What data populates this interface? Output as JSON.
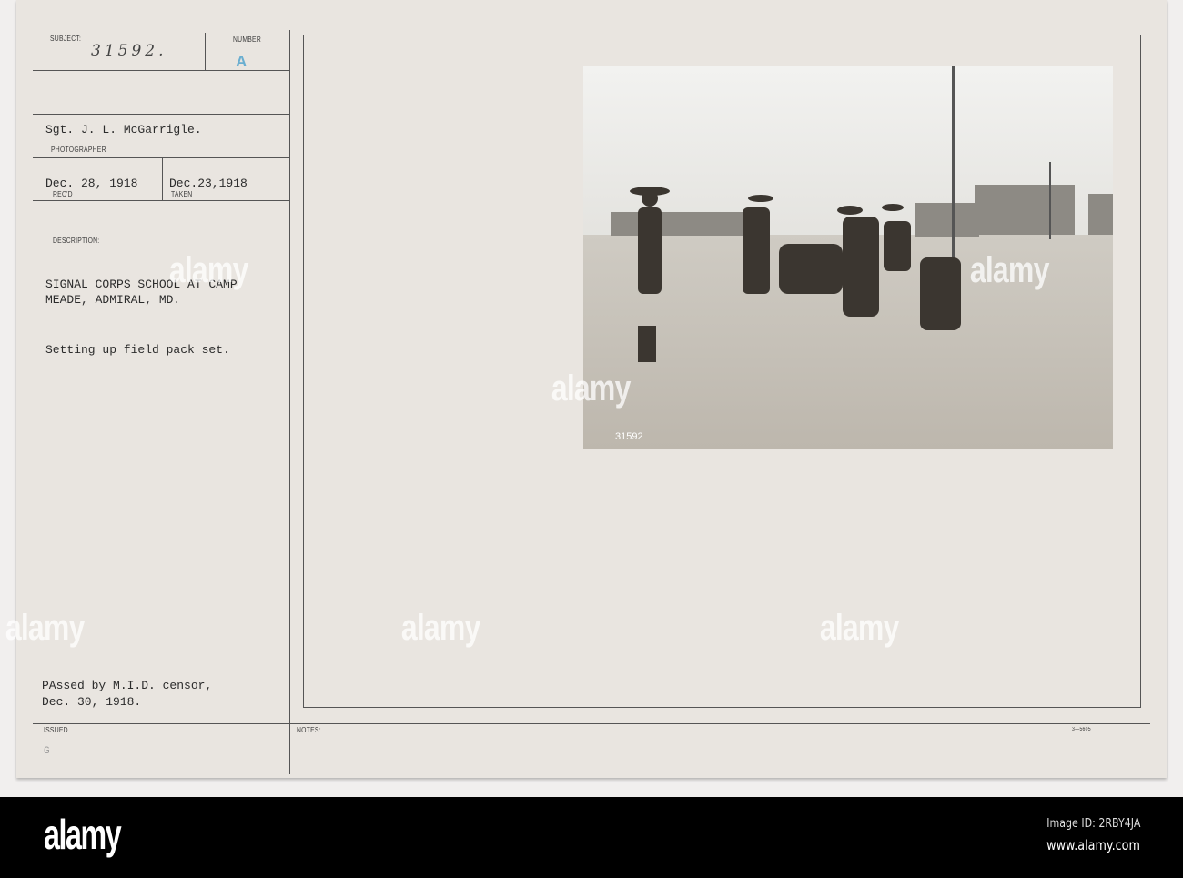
{
  "card": {
    "subject_label": "SUBJECT:",
    "subject_value": "31592.",
    "number_label": "NUMBER",
    "number_value": "A",
    "photographer": "Sgt. J. L. McGarrigle.",
    "photographer_label": "PHOTOGRAPHER",
    "received_date": "Dec. 28, 1918",
    "received_label": "REC'D",
    "taken_date": "Dec.23,1918",
    "taken_label": "TAKEN",
    "description_label": "DESCRIPTION:",
    "description_line1": "SIGNAL CORPS SCHOOL AT CAMP",
    "description_line2": "MEADE, ADMIRAL, MD.",
    "caption": "Setting up field pack set.",
    "censor_line1": "PAssed by M.I.D. censor,",
    "censor_line2": "Dec. 30, 1918.",
    "issued_label": "ISSUED",
    "issued_mark": "G",
    "notes_label": "NOTES:",
    "form_number": "3—5605",
    "photo_negative_number": "31592"
  },
  "watermark": "alamy",
  "footer": {
    "logo": "alamy",
    "image_id": "Image ID: 2RBY4JA",
    "url": "www.alamy.com"
  }
}
